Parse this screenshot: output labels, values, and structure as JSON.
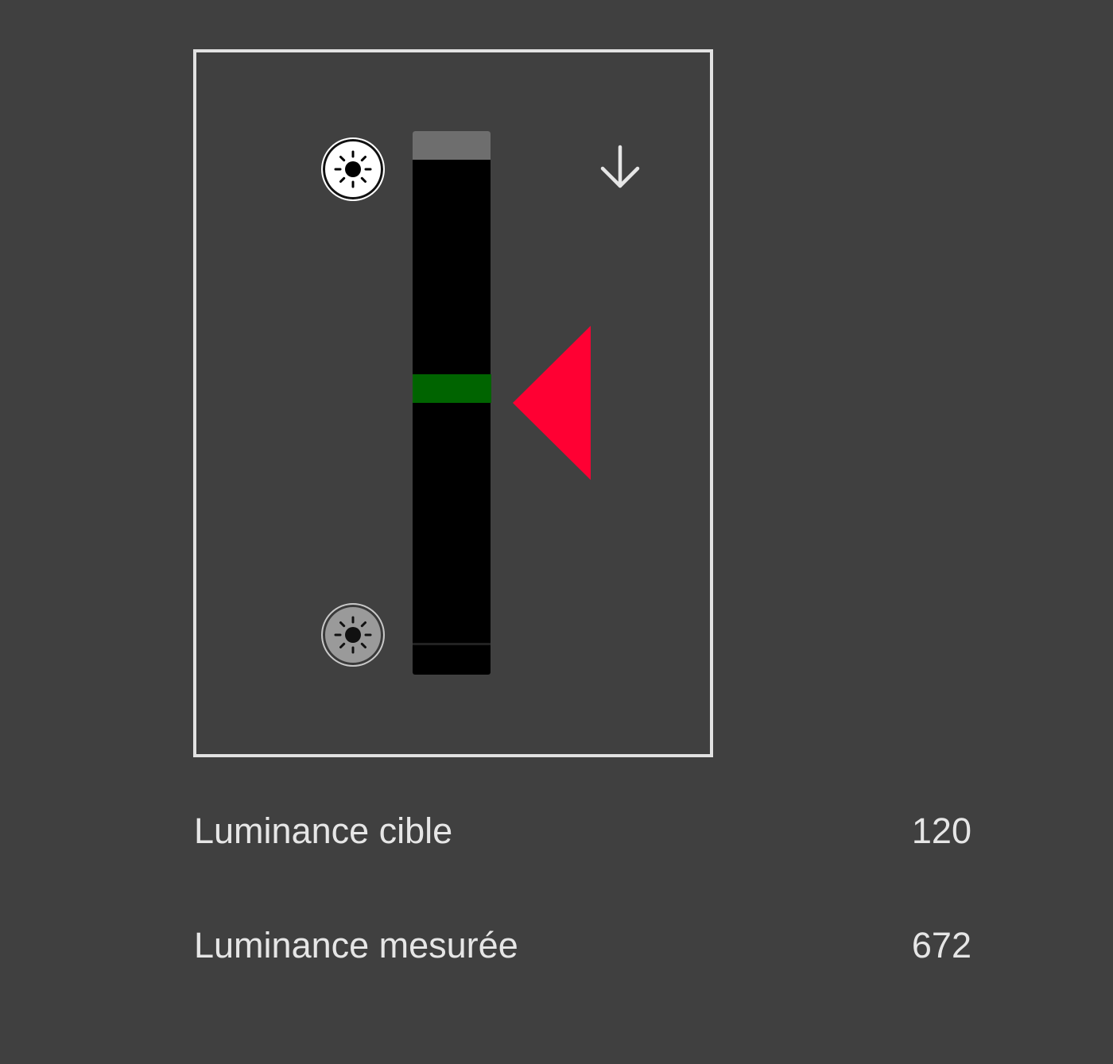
{
  "luminance": {
    "target_label": "Luminance cible",
    "target_value": "120",
    "measured_label": "Luminance mesurée",
    "measured_value": "672"
  },
  "icons": {
    "brightness_up": "brightness-high-icon",
    "brightness_down": "brightness-low-icon",
    "scroll_down": "arrow-down-icon",
    "measured_pointer": "triangle-pointer-left-icon"
  },
  "colors": {
    "background": "#404040",
    "panel_border": "#e2e2e2",
    "meter_track": "#000000",
    "target_band": "#006400",
    "measured_pointer": "#ff0033",
    "text": "#e6e6e6"
  }
}
